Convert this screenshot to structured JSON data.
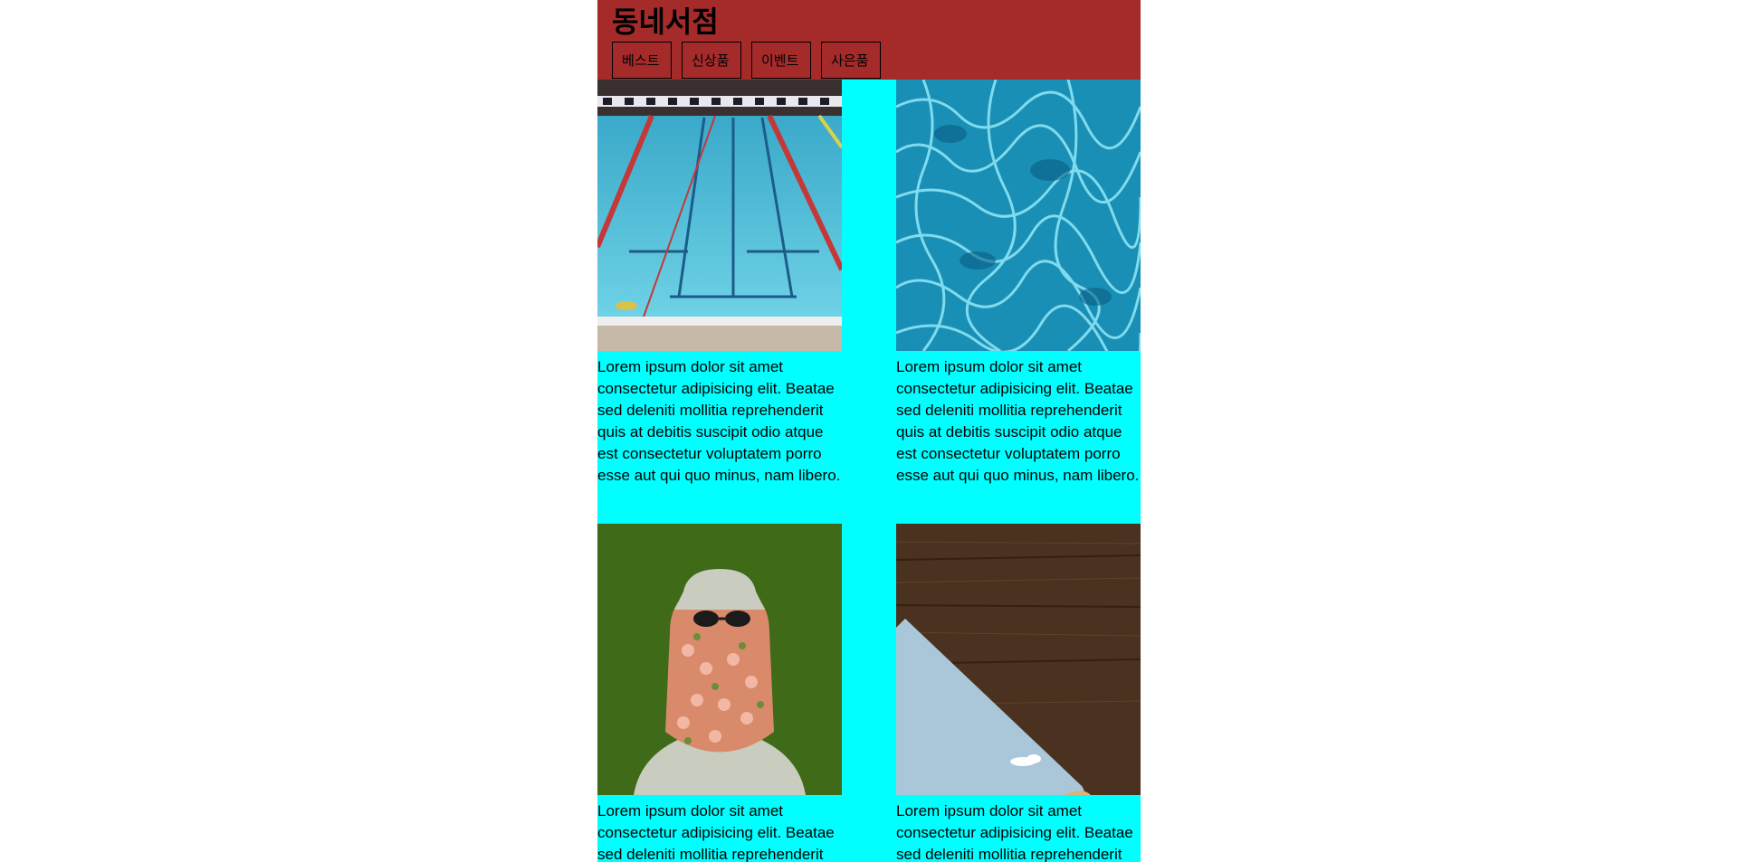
{
  "header": {
    "logo": "동네서점",
    "nav": [
      "베스트",
      "신상품",
      "이벤트",
      "사은품"
    ]
  },
  "cards": [
    {
      "image": "swimming-pool-lanes-photo",
      "text": "Lorem ipsum dolor sit amet consectetur adipisicing elit. Beatae sed deleniti mollitia reprehenderit quis at debitis suscipit odio atque est consectetur voluptatem porro esse aut qui quo minus, nam libero."
    },
    {
      "image": "water-surface-ripples-photo",
      "text": "Lorem ipsum dolor sit amet consectetur adipisicing elit. Beatae sed deleniti mollitia reprehenderit quis at debitis suscipit odio atque est consectetur voluptatem porro esse aut qui quo minus, nam libero."
    },
    {
      "image": "person-with-flowers-photo",
      "text": "Lorem ipsum dolor sit amet consectetur adipisicing elit. Beatae sed deleniti mollitia reprehenderit"
    },
    {
      "image": "tablet-on-wood-photo",
      "text": "Lorem ipsum dolor sit amet consectetur adipisicing elit. Beatae sed deleniti mollitia reprehenderit"
    }
  ],
  "colors": {
    "header_bg": "#a52a2a",
    "page_bg": "#00ffff"
  }
}
